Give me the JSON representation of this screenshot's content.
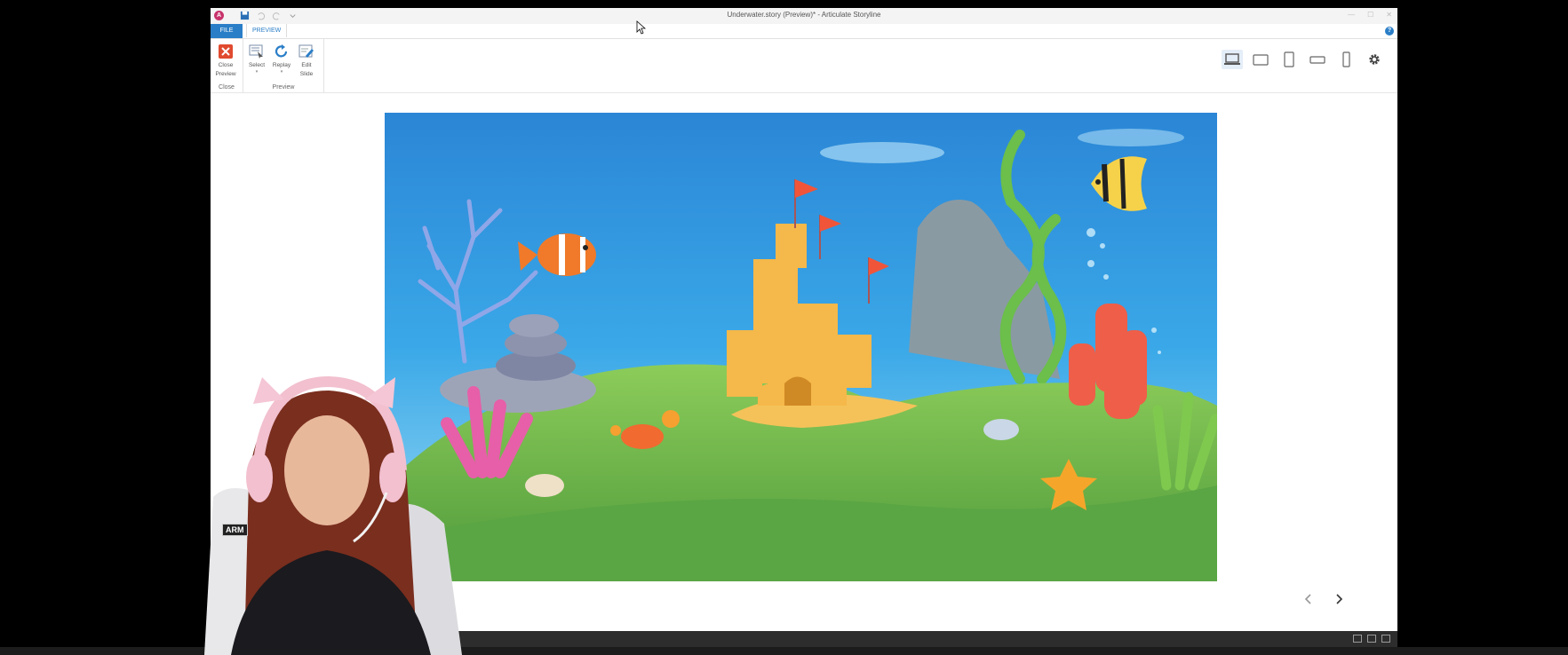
{
  "window": {
    "title": "Underwater.story (Preview)* - Articulate Storyline",
    "app_logo": "A"
  },
  "tabs": {
    "file": "FILE",
    "preview": "PREVIEW"
  },
  "help": "?",
  "ribbon": {
    "close_group": {
      "button_label_1": "Close",
      "button_label_2": "Preview",
      "group_label": "Close"
    },
    "preview_group": {
      "select_label": "Select",
      "replay_label": "Replay",
      "edit_label_1": "Edit",
      "edit_label_2": "Slide",
      "group_label": "Preview"
    }
  },
  "device_switcher": {
    "items": [
      "desktop-icon",
      "tablet-landscape-icon",
      "tablet-portrait-icon",
      "phone-landscape-icon",
      "phone-portrait-icon",
      "gear-icon"
    ],
    "selected": "desktop-icon"
  },
  "webcam": {
    "logo_text": "ARM"
  },
  "colors": {
    "accent": "#2a7ec7",
    "close_red": "#e04a2f",
    "water_top": "#2b86d6",
    "sand": "#f5b84a",
    "grass": "#6fb24a"
  }
}
